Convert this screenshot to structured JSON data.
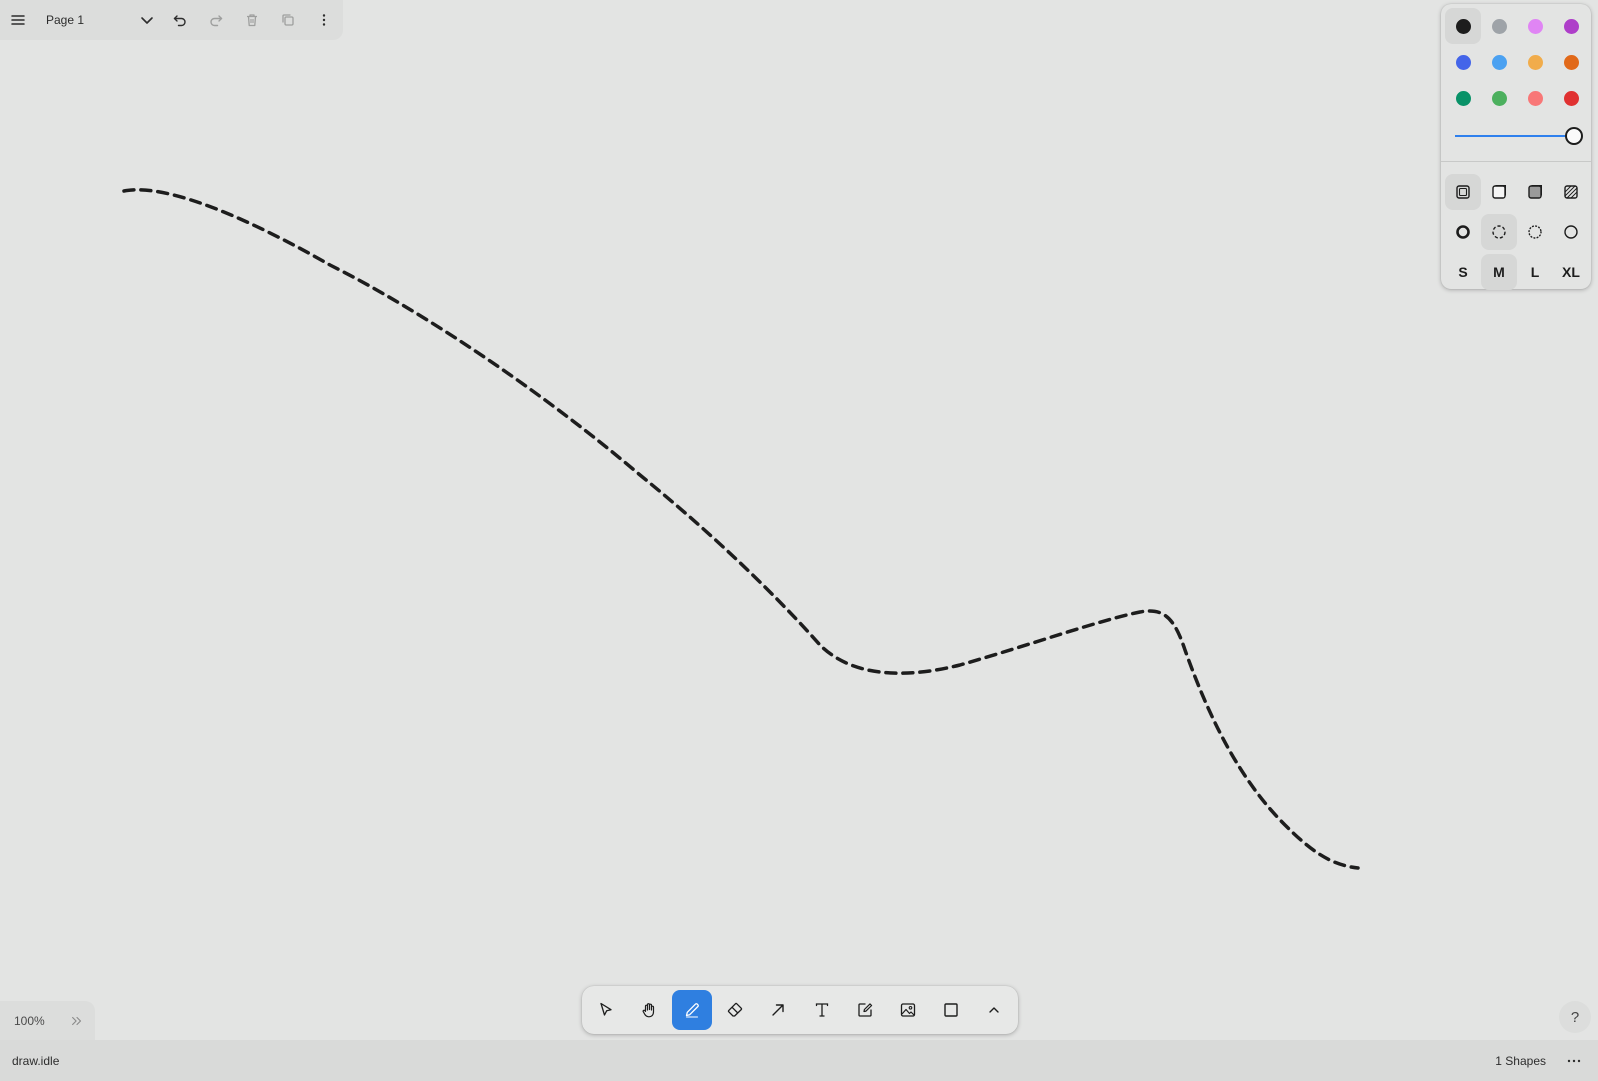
{
  "menu": {
    "page_name": "Page 1",
    "icons": [
      "hamburger-menu-icon",
      "chevron-down-icon",
      "undo-icon",
      "redo-icon",
      "trash-icon",
      "duplicate-icon",
      "more-vertical-icon"
    ]
  },
  "style_panel": {
    "colors": [
      {
        "name": "black",
        "hex": "#1d1d1d",
        "selected": true
      },
      {
        "name": "grey",
        "hex": "#9ea3a8",
        "selected": false
      },
      {
        "name": "light-violet",
        "hex": "#e085f4",
        "selected": false
      },
      {
        "name": "violet",
        "hex": "#ae3ec9",
        "selected": false
      },
      {
        "name": "blue",
        "hex": "#4465e9",
        "selected": false
      },
      {
        "name": "light-blue",
        "hex": "#4ba1f1",
        "selected": false
      },
      {
        "name": "yellow",
        "hex": "#f1ac4b",
        "selected": false
      },
      {
        "name": "orange",
        "hex": "#e16919",
        "selected": false
      },
      {
        "name": "green",
        "hex": "#099268",
        "selected": false
      },
      {
        "name": "light-green",
        "hex": "#4cb05e",
        "selected": false
      },
      {
        "name": "light-red",
        "hex": "#f87777",
        "selected": false
      },
      {
        "name": "red",
        "hex": "#e03131",
        "selected": false
      }
    ],
    "opacity": 1.0,
    "fill_options": [
      "fill-none-icon",
      "fill-semi-icon",
      "fill-solid-icon",
      "fill-pattern-icon"
    ],
    "fill_selected": 0,
    "dash_options": [
      "dash-draw-icon",
      "dash-dashed-icon",
      "dash-dotted-icon",
      "dash-solid-icon"
    ],
    "dash_selected": 1,
    "sizes": [
      "S",
      "M",
      "L",
      "XL"
    ],
    "size_selected": 1
  },
  "zoom": {
    "level": "100%"
  },
  "toolbar": {
    "tools": [
      {
        "name": "select-tool",
        "icon": "cursor-icon"
      },
      {
        "name": "hand-tool",
        "icon": "hand-icon"
      },
      {
        "name": "draw-tool",
        "icon": "pencil-icon",
        "active": true
      },
      {
        "name": "eraser-tool",
        "icon": "eraser-icon"
      },
      {
        "name": "arrow-tool",
        "icon": "arrow-icon"
      },
      {
        "name": "text-tool",
        "icon": "text-icon"
      },
      {
        "name": "note-tool",
        "icon": "note-icon"
      },
      {
        "name": "image-tool",
        "icon": "image-icon"
      },
      {
        "name": "rectangle-tool",
        "icon": "rectangle-icon"
      },
      {
        "name": "more-tools",
        "icon": "chevron-up-icon"
      }
    ]
  },
  "help": {
    "label": "?"
  },
  "status": {
    "state": "draw.idle",
    "shape_count": "1 Shapes"
  },
  "canvas": {
    "shapes": [
      {
        "type": "draw",
        "color": "#1d1d1d",
        "dash": "dashed",
        "size": "M"
      }
    ]
  }
}
